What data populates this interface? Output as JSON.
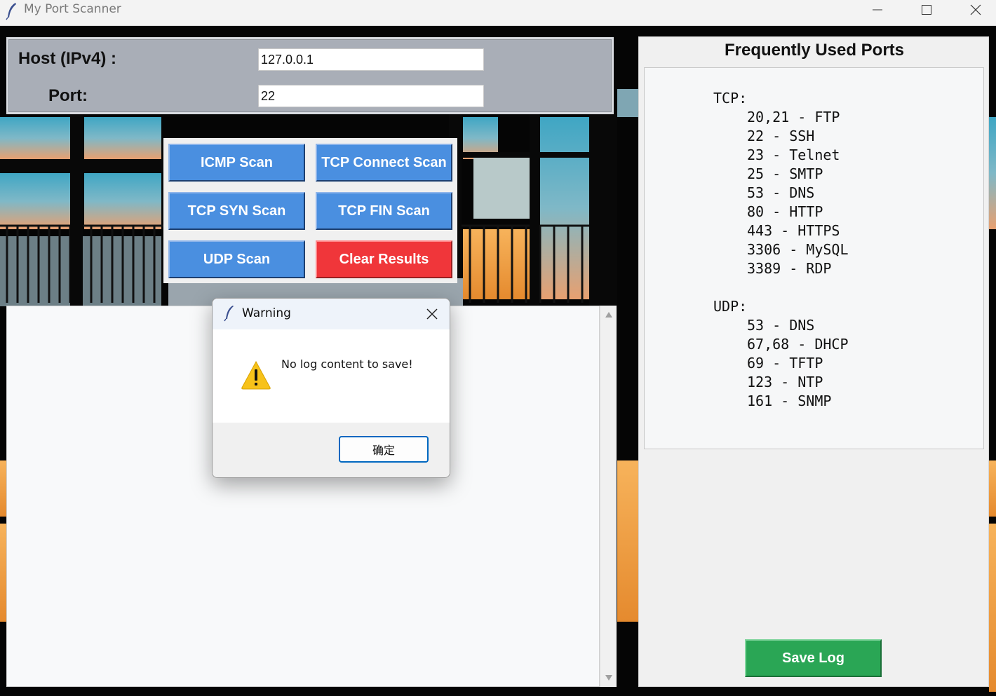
{
  "window": {
    "title": "My Port Scanner",
    "icon": "feather-icon",
    "controls": [
      "minimize-icon",
      "maximize-icon",
      "close-icon"
    ]
  },
  "form": {
    "host_label": "Host (IPv4) :",
    "host_value": "127.0.0.1",
    "port_label": "Port:",
    "port_value": "22"
  },
  "buttons": {
    "icmp": "ICMP Scan",
    "tcp_connect": "TCP Connect Scan",
    "tcp_syn": "TCP SYN Scan",
    "tcp_fin": "TCP FIN Scan",
    "udp": "UDP Scan",
    "clear": "Clear Results"
  },
  "ports_panel": {
    "title": "Frequently Used Ports",
    "tcp_header": "TCP:",
    "tcp": [
      "20,21 - FTP",
      "22 - SSH",
      "23 - Telnet",
      "25 - SMTP",
      "53 - DNS",
      "80 - HTTP",
      "443 - HTTPS",
      "3306 - MySQL",
      "3389 - RDP"
    ],
    "udp_header": "UDP:",
    "udp": [
      "53 - DNS",
      "67,68 - DHCP",
      "69 - TFTP",
      "123 - NTP",
      "161 - SNMP"
    ]
  },
  "save_log": "Save Log",
  "dialog": {
    "title": "Warning",
    "message": "No log content to save!",
    "ok": "确定",
    "icon": "warning-icon"
  },
  "colors": {
    "button_blue": "#4a8fe0",
    "button_red": "#f0363a",
    "save_green": "#2aa655",
    "panel_gray": "#a9aeb7"
  }
}
